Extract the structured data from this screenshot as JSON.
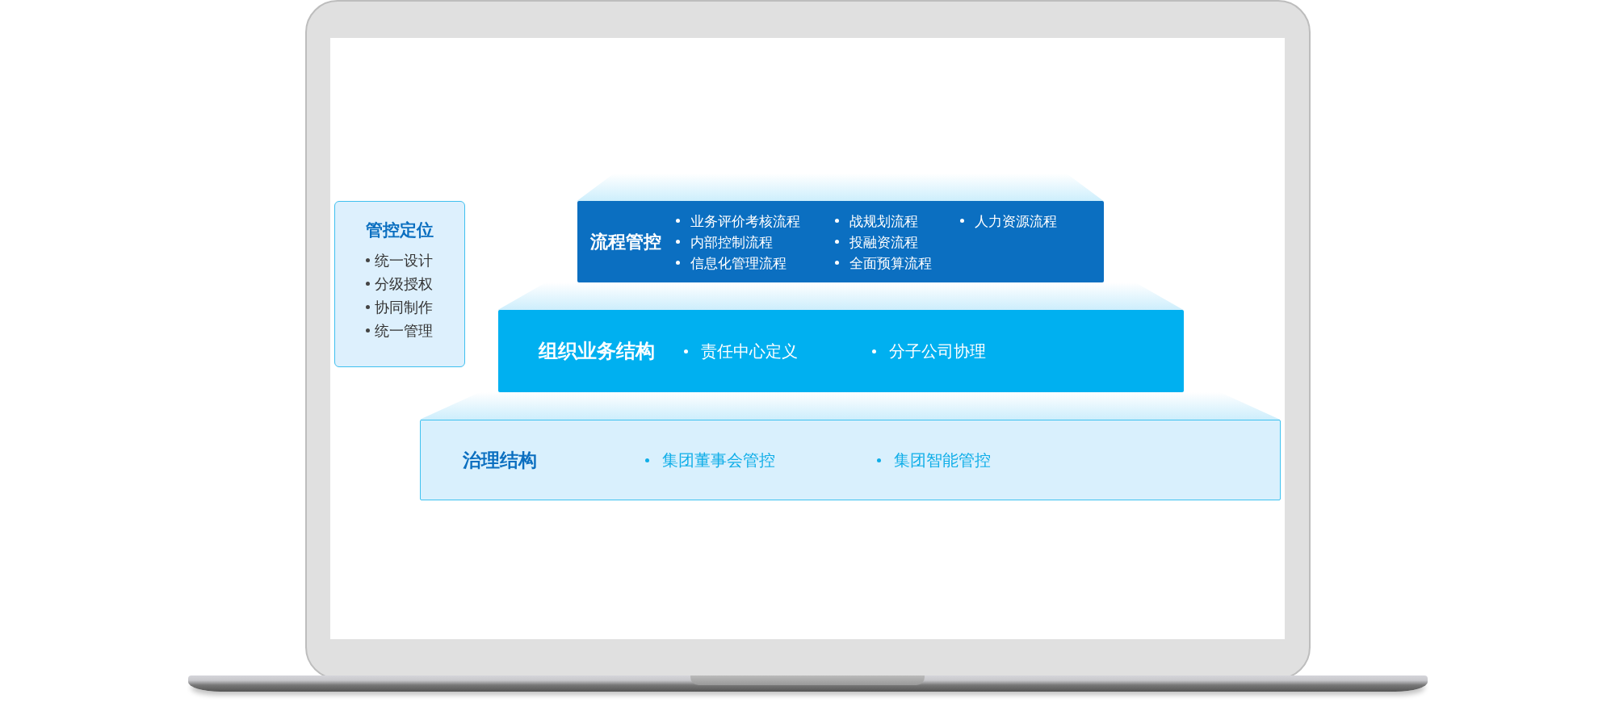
{
  "position_box": {
    "title": "管控定位",
    "items": [
      "统一设计",
      "分级授权",
      "协同制作",
      "统一管理"
    ]
  },
  "tiers": [
    {
      "kind": "process",
      "title": "流程管控",
      "columns": [
        [
          "业务评价考核流程",
          "内部控制流程",
          "信息化管理流程"
        ],
        [
          "战规划流程",
          "投融资流程",
          "全面预算流程"
        ],
        [
          "人力资源流程"
        ]
      ]
    },
    {
      "kind": "organization",
      "title": "组织业务结构",
      "columns": [
        [
          "责任中心定义"
        ],
        [
          "分子公司协理"
        ]
      ]
    },
    {
      "kind": "governance",
      "title": "治理结构",
      "columns": [
        [
          "集团董事会管控"
        ],
        [
          "集团智能管控"
        ]
      ]
    }
  ]
}
